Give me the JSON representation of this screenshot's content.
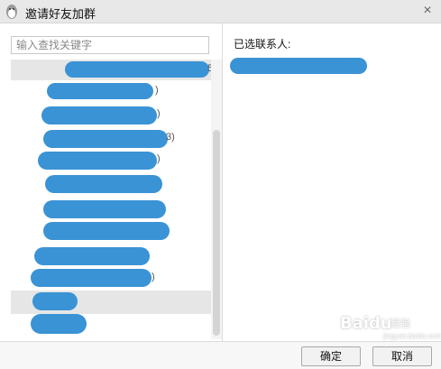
{
  "window": {
    "title": "邀请好友加群",
    "close_icon": "×"
  },
  "search": {
    "placeholder": "输入查找关键字",
    "value": ""
  },
  "contacts": {
    "visible_suffixes": [
      "5)",
      ")",
      ")",
      "3)",
      ")",
      ")",
      ")"
    ]
  },
  "selected": {
    "label": "已选联系人:"
  },
  "footer": {
    "ok_label": "确定",
    "cancel_label": "取消"
  },
  "watermark": {
    "brand": "Baidu",
    "sub": "经验",
    "url": "jingyan.baidu.com"
  },
  "colors": {
    "redaction": "#3a93d5",
    "titlebar": "#e8e8e8",
    "group_row": "#e6e6e6"
  }
}
